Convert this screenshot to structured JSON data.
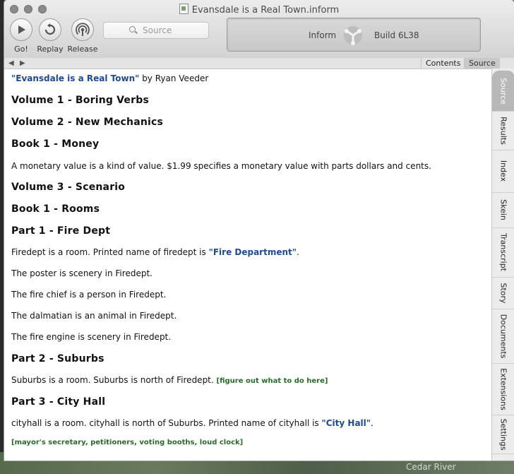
{
  "window": {
    "title": "Evansdale is a Real Town.inform"
  },
  "toolbar": {
    "go_label": "Go!",
    "replay_label": "Replay",
    "release_label": "Release",
    "search_placeholder": "Source"
  },
  "status": {
    "app_name": "Inform",
    "build": "Build 6L38"
  },
  "tabs": {
    "contents": "Contents",
    "source": "Source"
  },
  "side_tabs": [
    "Source",
    "Results",
    "Index",
    "Skein",
    "Transcript",
    "Story",
    "Documents",
    "Extensions",
    "Settings"
  ],
  "source": {
    "title_quoted": "\"Evansdale is a Real Town\"",
    "author_text": " by Ryan Veeder",
    "volume1": "Volume 1 - Boring Verbs",
    "volume2": "Volume 2 - New Mechanics",
    "book1_money": "Book 1 - Money",
    "money_text": "A monetary value is a kind of value. $1.99 specifies a monetary value with parts dollars and cents.",
    "volume3": "Volume 3 - Scenario",
    "book1_rooms": "Book 1 - Rooms",
    "part1": "Part 1 - Fire Dept",
    "firedept_text": "Firedept is a room. Printed name of firedept is ",
    "firedept_name": "\"Fire Department\"",
    "firedept_end": ".",
    "poster": "The poster is scenery in Firedept.",
    "chief": "The fire chief is a person in Firedept.",
    "dalmatian": "The dalmatian is an animal in Firedept.",
    "engine": "The fire engine is scenery in Firedept.",
    "part2": "Part 2 - Suburbs",
    "suburbs_text": "Suburbs is a room. Suburbs is north of Firedept. ",
    "suburbs_note": "[figure out what to do here]",
    "part3": "Part 3 - City Hall",
    "cityhall_text": "cityhall is a room. cityhall is north of Suburbs. Printed name of cityhall is ",
    "cityhall_name": "\"City Hall\"",
    "cityhall_end": ".",
    "cityhall_note": "[mayor's secretary, petitioners, voting booths, loud clock]"
  },
  "desktop": {
    "map_label": "Cedar River"
  }
}
